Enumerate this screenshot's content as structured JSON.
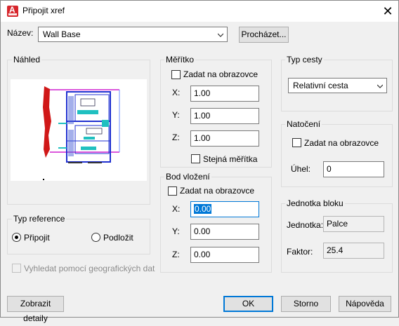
{
  "window": {
    "title": "Připojit xref",
    "close_glyph": "✕"
  },
  "name": {
    "label": "Název:",
    "value": "Wall Base",
    "browse_label": "Procházet..."
  },
  "preview": {
    "title": "Náhled"
  },
  "scale": {
    "title": "Měřítko",
    "specify_on_screen": "Zadat na obrazovce",
    "x_label": "X:",
    "x_value": "1.00",
    "y_label": "Y:",
    "y_value": "1.00",
    "z_label": "Z:",
    "z_value": "1.00",
    "uniform_scale": "Stejná měřítka"
  },
  "insertion_point": {
    "title": "Bod vložení",
    "specify_on_screen": "Zadat na obrazovce",
    "x_label": "X:",
    "x_value": "0.00",
    "y_label": "Y:",
    "y_value": "0.00",
    "z_label": "Z:",
    "z_value": "0.00"
  },
  "path_type": {
    "title": "Typ cesty",
    "value": "Relativní cesta"
  },
  "rotation": {
    "title": "Natočení",
    "specify_on_screen": "Zadat na obrazovce",
    "angle_label": "Úhel:",
    "angle_value": "0"
  },
  "block_unit": {
    "title": "Jednotka bloku",
    "unit_label": "Jednotka:",
    "unit_value": "Palce",
    "factor_label": "Faktor:",
    "factor_value": "25.4"
  },
  "reference_type": {
    "title": "Typ reference",
    "attach_label": "Připojit",
    "overlay_label": "Podložit",
    "selected": "attach"
  },
  "geo": {
    "label": "Vyhledat pomocí geografických dat"
  },
  "footer": {
    "details_label": "Zobrazit detaily",
    "ok_label": "OK",
    "cancel_label": "Storno",
    "help_label": "Nápověda"
  },
  "colors": {
    "accent": "#0078d7",
    "brand_red": "#d7262c"
  }
}
